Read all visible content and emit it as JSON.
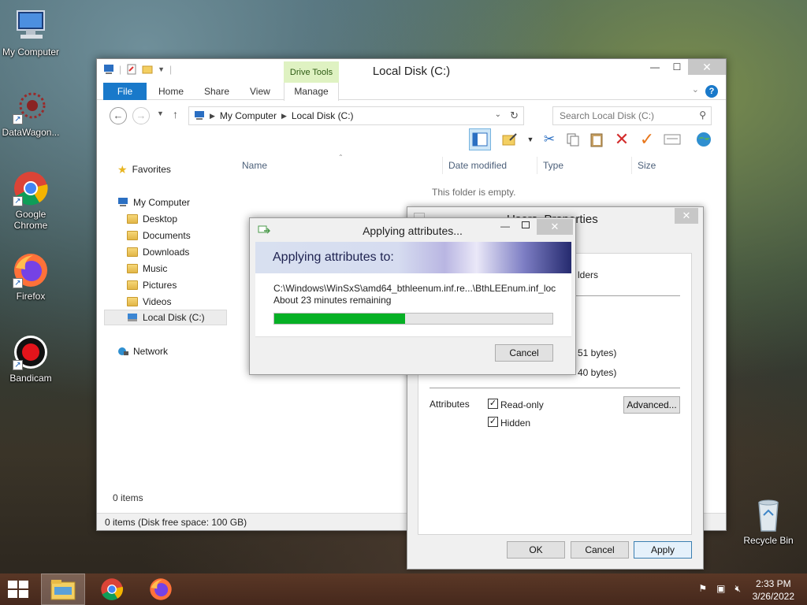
{
  "desktop": {
    "icons": [
      {
        "label": "My Computer"
      },
      {
        "label": "DataWagon..."
      },
      {
        "label": "Google Chrome"
      },
      {
        "label": "Firefox"
      },
      {
        "label": "Bandicam"
      },
      {
        "label": "Recycle Bin"
      }
    ]
  },
  "explorer": {
    "title": "Local Disk (C:)",
    "contextual_group": "Drive Tools",
    "tabs": [
      "File",
      "Home",
      "Share",
      "View",
      "Manage"
    ],
    "address": {
      "crumbs": [
        "My Computer",
        "Local Disk (C:)"
      ]
    },
    "search_placeholder": "Search Local Disk (C:)",
    "nav": {
      "favorites": "Favorites",
      "my_computer": "My Computer",
      "folders": [
        "Desktop",
        "Documents",
        "Downloads",
        "Music",
        "Pictures",
        "Videos"
      ],
      "selected_drive": "Local Disk (C:)",
      "network": "Network"
    },
    "columns": [
      "Name",
      "Date modified",
      "Type",
      "Size"
    ],
    "empty_message": "This folder is empty.",
    "item_count": "0 items",
    "status": "0 items (Disk free space: 100 GB)"
  },
  "properties": {
    "title_fragment_left": "Users",
    "title_fragment_right": "Properties",
    "contains_fragment": "lders",
    "size_fragment_1": "51 bytes)",
    "size_fragment_2": "40 bytes)",
    "attributes_label": "Attributes",
    "readonly_label": "Read-only",
    "readonly_checked": true,
    "hidden_label": "Hidden",
    "hidden_checked": true,
    "advanced_button": "Advanced...",
    "ok_button": "OK",
    "cancel_button": "Cancel",
    "apply_button": "Apply"
  },
  "applying": {
    "title": "Applying attributes...",
    "heading": "Applying attributes to:",
    "path": "C:\\Windows\\WinSxS\\amd64_bthleenum.inf.re...\\BthLEEnum.inf_loc",
    "remaining": "About 23 minutes remaining",
    "progress_fraction": 0.47,
    "cancel_button": "Cancel",
    "progress_color": "#06b025"
  },
  "taskbar": {
    "time": "2:33 PM",
    "date": "3/26/2022"
  }
}
